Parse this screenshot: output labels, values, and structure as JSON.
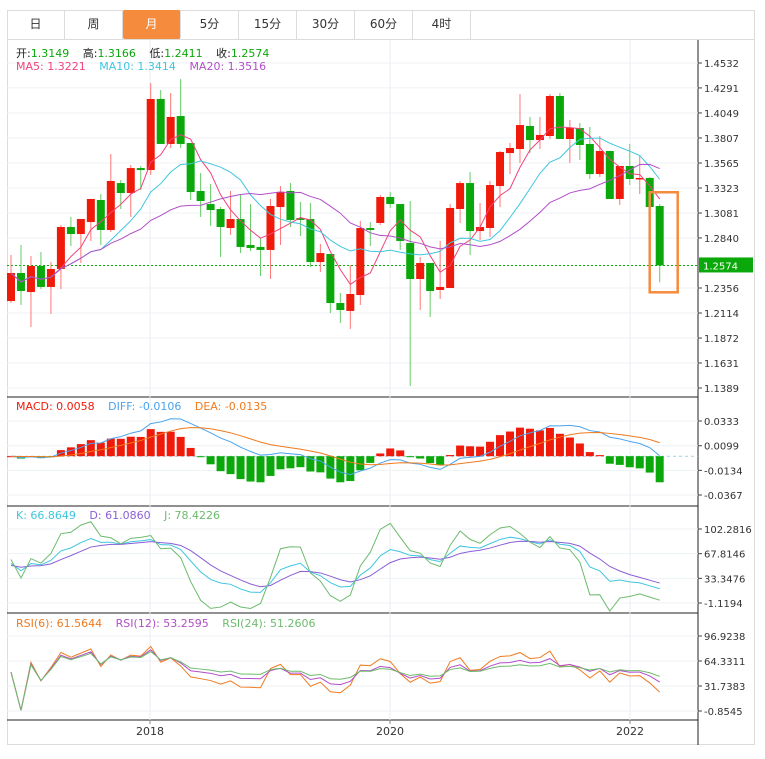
{
  "tabs": [
    {
      "label": "日",
      "active": false
    },
    {
      "label": "周",
      "active": false
    },
    {
      "label": "月",
      "active": true
    },
    {
      "label": "5分",
      "active": false
    },
    {
      "label": "15分",
      "active": false
    },
    {
      "label": "30分",
      "active": false
    },
    {
      "label": "60分",
      "active": false
    },
    {
      "label": "4时",
      "active": false
    }
  ],
  "ohlc_legend": {
    "open_label": "开:",
    "open": "1.3149",
    "high_label": "高:",
    "high": "1.3166",
    "low_label": "低:",
    "low": "1.2411",
    "close_label": "收:",
    "close": "1.2574"
  },
  "ma_legend": {
    "ma5": "MA5: 1.3221",
    "ma10": "MA10: 1.3414",
    "ma20": "MA20: 1.3516"
  },
  "macd_legend": {
    "macd": "MACD: 0.0058",
    "diff": "DIFF: -0.0106",
    "dea": "DEA: -0.0135"
  },
  "kdj_legend": {
    "k": "K: 66.8649",
    "d": "D: 61.0860",
    "j": "J: 78.4226"
  },
  "rsi_legend": {
    "rsi6": "RSI(6): 61.5644",
    "rsi12": "RSI(12): 53.2595",
    "rsi24": "RSI(24): 51.2606"
  },
  "colors": {
    "up": "#f01a0a",
    "down": "#0aa80a",
    "ma5": "#f0427d",
    "ma10": "#3fc6de",
    "ma20": "#b24ec9",
    "diff": "#4aa3ee",
    "dea": "#f07a1e",
    "k": "#3fc6de",
    "d": "#8a5fd6",
    "j": "#6dbb6d",
    "rsi6": "#f07a1e",
    "rsi12": "#b24ec9",
    "rsi24": "#6dbb6d",
    "active_tab": "#f58b3c",
    "highlight": "#f58b3c"
  },
  "chart_data": {
    "type": "candlestick",
    "interval": "monthly",
    "x_tick_labels": [
      "2018",
      "2020",
      "2022"
    ],
    "price_axis_ticks": [
      "1.4532",
      "1.4291",
      "1.4049",
      "1.3807",
      "1.3565",
      "1.3323",
      "1.3081",
      "1.2840",
      "1.2356",
      "1.2114",
      "1.1872",
      "1.1631",
      "1.1389"
    ],
    "last_price": "1.2574",
    "macd_axis_ticks": [
      "0.0333",
      "0.0099",
      "-0.0134",
      "-0.0367"
    ],
    "kdj_axis_ticks": [
      "102.2816",
      "67.8146",
      "33.3476",
      "-1.1194"
    ],
    "rsi_axis_ticks": [
      "96.9238",
      "64.3311",
      "31.7383",
      "-0.8545"
    ],
    "first_month": "2016-11",
    "highlighted_candle": "last",
    "candles_ohlc": [
      [
        1.223,
        1.2675,
        1.2211,
        1.2501
      ],
      [
        1.2501,
        1.2772,
        1.2192,
        1.2327
      ],
      [
        1.2317,
        1.2665,
        1.1979,
        1.2569
      ],
      [
        1.2569,
        1.2704,
        1.2346,
        1.2366
      ],
      [
        1.2366,
        1.2607,
        1.2105,
        1.254
      ],
      [
        1.254,
        1.2965,
        1.2346,
        1.2946
      ],
      [
        1.2946,
        1.3043,
        1.2762,
        1.2878
      ],
      [
        1.2878,
        1.3023,
        1.2598,
        1.3023
      ],
      [
        1.2994,
        1.3217,
        1.2811,
        1.3217
      ],
      [
        1.3207,
        1.3265,
        1.2772,
        1.2917
      ],
      [
        1.2917,
        1.3652,
        1.2898,
        1.3391
      ],
      [
        1.3371,
        1.34,
        1.312,
        1.3275
      ],
      [
        1.3275,
        1.3545,
        1.3043,
        1.3516
      ],
      [
        1.3516,
        1.3536,
        1.3304,
        1.3497
      ],
      [
        1.3497,
        1.4338,
        1.3449,
        1.4184
      ],
      [
        1.4184,
        1.4271,
        1.3749,
        1.3749
      ],
      [
        1.3749,
        1.4242,
        1.371,
        1.401
      ],
      [
        1.4019,
        1.4377,
        1.371,
        1.3749
      ],
      [
        1.3758,
        1.3758,
        1.3207,
        1.3284
      ],
      [
        1.3294,
        1.3468,
        1.3043,
        1.3197
      ],
      [
        1.3168,
        1.3362,
        1.2956,
        1.311
      ],
      [
        1.312,
        1.3139,
        1.2656,
        1.2946
      ],
      [
        1.2936,
        1.3294,
        1.2869,
        1.3023
      ],
      [
        1.3023,
        1.3255,
        1.2694,
        1.2753
      ],
      [
        1.2772,
        1.3168,
        1.2714,
        1.2743
      ],
      [
        1.2753,
        1.284,
        1.2472,
        1.2724
      ],
      [
        1.2724,
        1.3217,
        1.2443,
        1.3149
      ],
      [
        1.3139,
        1.3342,
        1.2772,
        1.3284
      ],
      [
        1.3294,
        1.3371,
        1.2946,
        1.3014
      ],
      [
        1.3033,
        1.3188,
        1.2859,
        1.3014
      ],
      [
        1.3023,
        1.3178,
        1.2559,
        1.2607
      ],
      [
        1.2607,
        1.2782,
        1.2511,
        1.2694
      ],
      [
        1.2685,
        1.2685,
        1.2114,
        1.2211
      ],
      [
        1.2211,
        1.2308,
        1.2018,
        1.2143
      ],
      [
        1.2134,
        1.2578,
        1.196,
        1.2298
      ],
      [
        1.2288,
        1.3004,
        1.2192,
        1.2936
      ],
      [
        1.2936,
        1.2994,
        1.2762,
        1.2917
      ],
      [
        1.2985,
        1.3255,
        1.2965,
        1.3236
      ],
      [
        1.3236,
        1.3284,
        1.313,
        1.3168
      ],
      [
        1.3168,
        1.3168,
        1.2724,
        1.2811
      ],
      [
        1.2791,
        1.3197,
        1.1408,
        1.2443
      ],
      [
        1.2443,
        1.2656,
        1.2143,
        1.2598
      ],
      [
        1.2598,
        1.2598,
        1.2076,
        1.2327
      ],
      [
        1.2337,
        1.2811,
        1.225,
        1.2366
      ],
      [
        1.2356,
        1.3168,
        1.2356,
        1.313
      ],
      [
        1.312,
        1.3391,
        1.2985,
        1.3371
      ],
      [
        1.3371,
        1.3478,
        1.2675,
        1.2907
      ],
      [
        1.2907,
        1.3178,
        1.282,
        1.2946
      ],
      [
        1.2936,
        1.3391,
        1.2849,
        1.3352
      ],
      [
        1.3342,
        1.3681,
        1.3139,
        1.3671
      ],
      [
        1.3661,
        1.3758,
        1.3458,
        1.371
      ],
      [
        1.37,
        1.4232,
        1.3565,
        1.3932
      ],
      [
        1.3923,
        1.401,
        1.3661,
        1.3787
      ],
      [
        1.3787,
        1.401,
        1.37,
        1.3836
      ],
      [
        1.3826,
        1.4232,
        1.3797,
        1.4213
      ],
      [
        1.4213,
        1.4242,
        1.3797,
        1.3797
      ],
      [
        1.3797,
        1.3981,
        1.3565,
        1.3903
      ],
      [
        1.3903,
        1.3952,
        1.3594,
        1.3739
      ],
      [
        1.3749,
        1.3913,
        1.341,
        1.3458
      ],
      [
        1.3458,
        1.3826,
        1.3429,
        1.3681
      ],
      [
        1.3681,
        1.3681,
        1.3217,
        1.3217
      ],
      [
        1.3217,
        1.3536,
        1.3159,
        1.3536
      ],
      [
        1.3536,
        1.3749,
        1.3352,
        1.341
      ],
      [
        1.341,
        1.3632,
        1.3265,
        1.342
      ],
      [
        1.342,
        1.3429,
        1.2994,
        1.3139
      ],
      [
        1.3149,
        1.3166,
        1.2411,
        1.2574
      ]
    ]
  }
}
